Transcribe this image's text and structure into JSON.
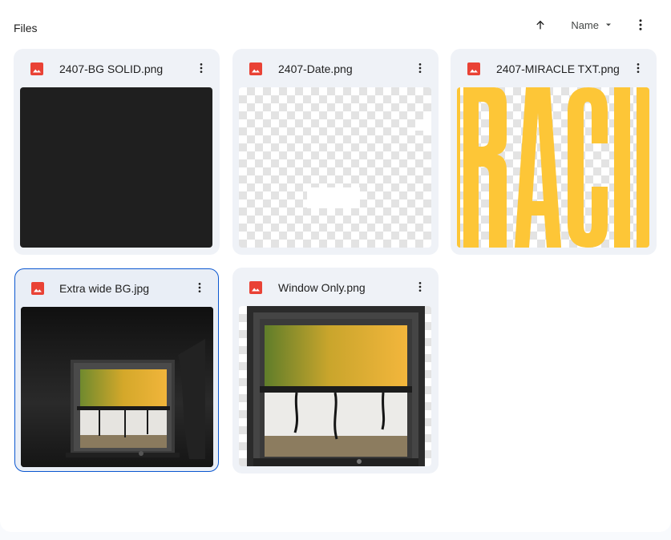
{
  "section": {
    "title": "Files"
  },
  "toolbar": {
    "sort_direction_icon": "arrow-up-icon",
    "sort_field": "Name",
    "more_icon": "more-vert-icon"
  },
  "files": [
    {
      "name": "2407-BG SOLID.png",
      "icon": "image-file-icon",
      "thumbnail": "solid-dark"
    },
    {
      "name": "2407-Date.png",
      "icon": "image-file-icon",
      "thumbnail": "transparent"
    },
    {
      "name": "2407-MIRACLE TXT.png",
      "icon": "image-file-icon",
      "thumbnail": "yellow-text"
    },
    {
      "name": "Extra wide BG.jpg",
      "icon": "image-file-icon",
      "thumbnail": "window-room",
      "selected": true
    },
    {
      "name": "Window Only.png",
      "icon": "image-file-icon",
      "thumbnail": "window-only"
    }
  ],
  "colors": {
    "accent": "#0b57d0",
    "image_icon": "#e94235",
    "thumb_yellow": "#fdc637",
    "thumb_dark": "#1f1f1f"
  }
}
